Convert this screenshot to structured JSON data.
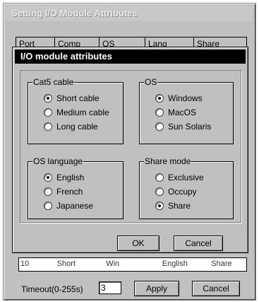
{
  "background_window": {
    "title": "Setting I/O Module Attributes",
    "columns": [
      "Port",
      "Comp",
      "OS",
      "Lang",
      "Share"
    ],
    "row": [
      "10",
      "Short",
      "Win",
      "English",
      "Share"
    ],
    "timeout_label": "Timeout(0-255s)",
    "timeout_value": "3",
    "apply_label": "Apply",
    "cancel_label": "Cancel"
  },
  "dialog": {
    "title": "I/O module attributes",
    "groups": {
      "cable": {
        "title": "Cat5 cable",
        "options": [
          "Short cable",
          "Medium cable",
          "Long cable"
        ],
        "selected": 0
      },
      "os": {
        "title": "OS",
        "options": [
          "Windows",
          "MacOS",
          "Sun Solaris"
        ],
        "selected": 0
      },
      "language": {
        "title": "OS language",
        "options": [
          "English",
          "French",
          "Japanese"
        ],
        "selected": 0
      },
      "share": {
        "title": "Share mode",
        "options": [
          "Exclusive",
          "Occupy",
          "Share"
        ],
        "selected": 2
      }
    },
    "ok_label": "OK",
    "cancel_label": "Cancel"
  }
}
